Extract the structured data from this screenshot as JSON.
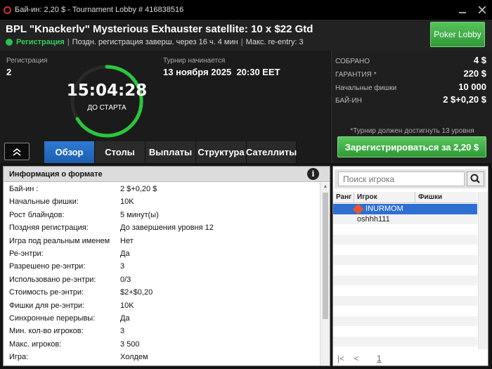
{
  "window": {
    "title": "Бай-ин: 2,20 $ - Tournament Lobby # 416838516"
  },
  "header": {
    "tournament_name": "BPL \"Knackerlv\" Mysterious Exhauster satellite: 10 x $22 Gtd",
    "status": "Регистрация",
    "late_reg": "Поздн. регистрация заверш. через 16 ч. 4 мин",
    "max_reentry": "Макс. re-entry: 3",
    "lobby_button": "Poker Lobby"
  },
  "info": {
    "reg_label": "Регистрация",
    "reg_value": "2",
    "timer": "15:04:28",
    "timer_sub": "ДО СТАРТА",
    "start_label": "Турнир начинается",
    "start_date": "13 ноября 2025",
    "start_time": "20:30 EET",
    "tabs": [
      "Обзор",
      "Столы",
      "Выплаты",
      "Структура",
      "Сателлиты"
    ],
    "active_tab": 0
  },
  "summary": {
    "rows": [
      {
        "label": "СОБРАНО",
        "value": "4 $"
      },
      {
        "label": "ГАРАНТИЯ *",
        "value": "220 $"
      },
      {
        "label": "Начальные фишки",
        "value": "10 000"
      },
      {
        "label": "БАЙ-ИН",
        "value": "2 $+0,20 $"
      }
    ],
    "note": "*Турнир должен достигнуть 13 уровня",
    "register_button": "Зарегистрироваться за  2,20 $"
  },
  "format": {
    "title": "Информация о формате",
    "rows": [
      {
        "k": "Бай-ин :",
        "v": "2 $+0,20 $"
      },
      {
        "k": "Начальные фишки:",
        "v": "10K"
      },
      {
        "k": "Рост блайндов:",
        "v": "5 минут(ы)"
      },
      {
        "k": "Поздняя регистрация:",
        "v": "До завершения уровня 12"
      },
      {
        "k": "Игра под реальным именем",
        "v": "Нет"
      },
      {
        "k": "Ре-энтри:",
        "v": "Да"
      },
      {
        "k": "Разрешено ре-энтри:",
        "v": "3"
      },
      {
        "k": "Использовано ре-энтри:",
        "v": "0/3"
      },
      {
        "k": "Стоимость ре-энтри:",
        "v": "$2+$0,20"
      },
      {
        "k": "Фишки для ре-энтри:",
        "v": "10K"
      },
      {
        "k": "Синхронные перерывы:",
        "v": "Да"
      },
      {
        "k": "Мин. кол-во игроков:",
        "v": "3"
      },
      {
        "k": "Макс. игроков:",
        "v": "3 500"
      },
      {
        "k": "Игра:",
        "v": "Холдем"
      }
    ]
  },
  "players": {
    "search_placeholder": "Поиск игрока",
    "columns": [
      "Ранг",
      "Игрок",
      "Фишки"
    ],
    "rows": [
      {
        "name": "INURMOM",
        "selected": true
      },
      {
        "name": "oshhh111",
        "selected": false
      }
    ],
    "page": "1"
  },
  "colors": {
    "accent_green": "#2e9a35",
    "tab_blue": "#1d5fb0",
    "status_green": "#32d05a",
    "selection_blue": "#2e6fd1"
  }
}
